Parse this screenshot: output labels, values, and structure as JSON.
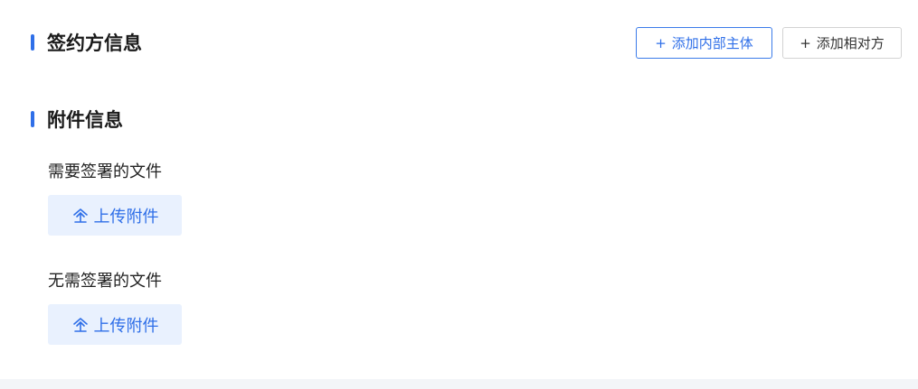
{
  "signatories": {
    "title": "签约方信息",
    "add_internal_label": "添加内部主体",
    "add_counterparty_label": "添加相对方",
    "plus_symbol": "+"
  },
  "attachments": {
    "title": "附件信息",
    "groups": [
      {
        "label": "需要签署的文件",
        "upload_label": "上传附件"
      },
      {
        "label": "无需签署的文件",
        "upload_label": "上传附件"
      }
    ]
  },
  "colors": {
    "accent": "#2f6fe8",
    "upload_bg": "#e9f1fe",
    "footer_bg": "#f3f5f8"
  },
  "icons": {
    "section_marker": "accent-bar",
    "upload": "upload-icon"
  }
}
